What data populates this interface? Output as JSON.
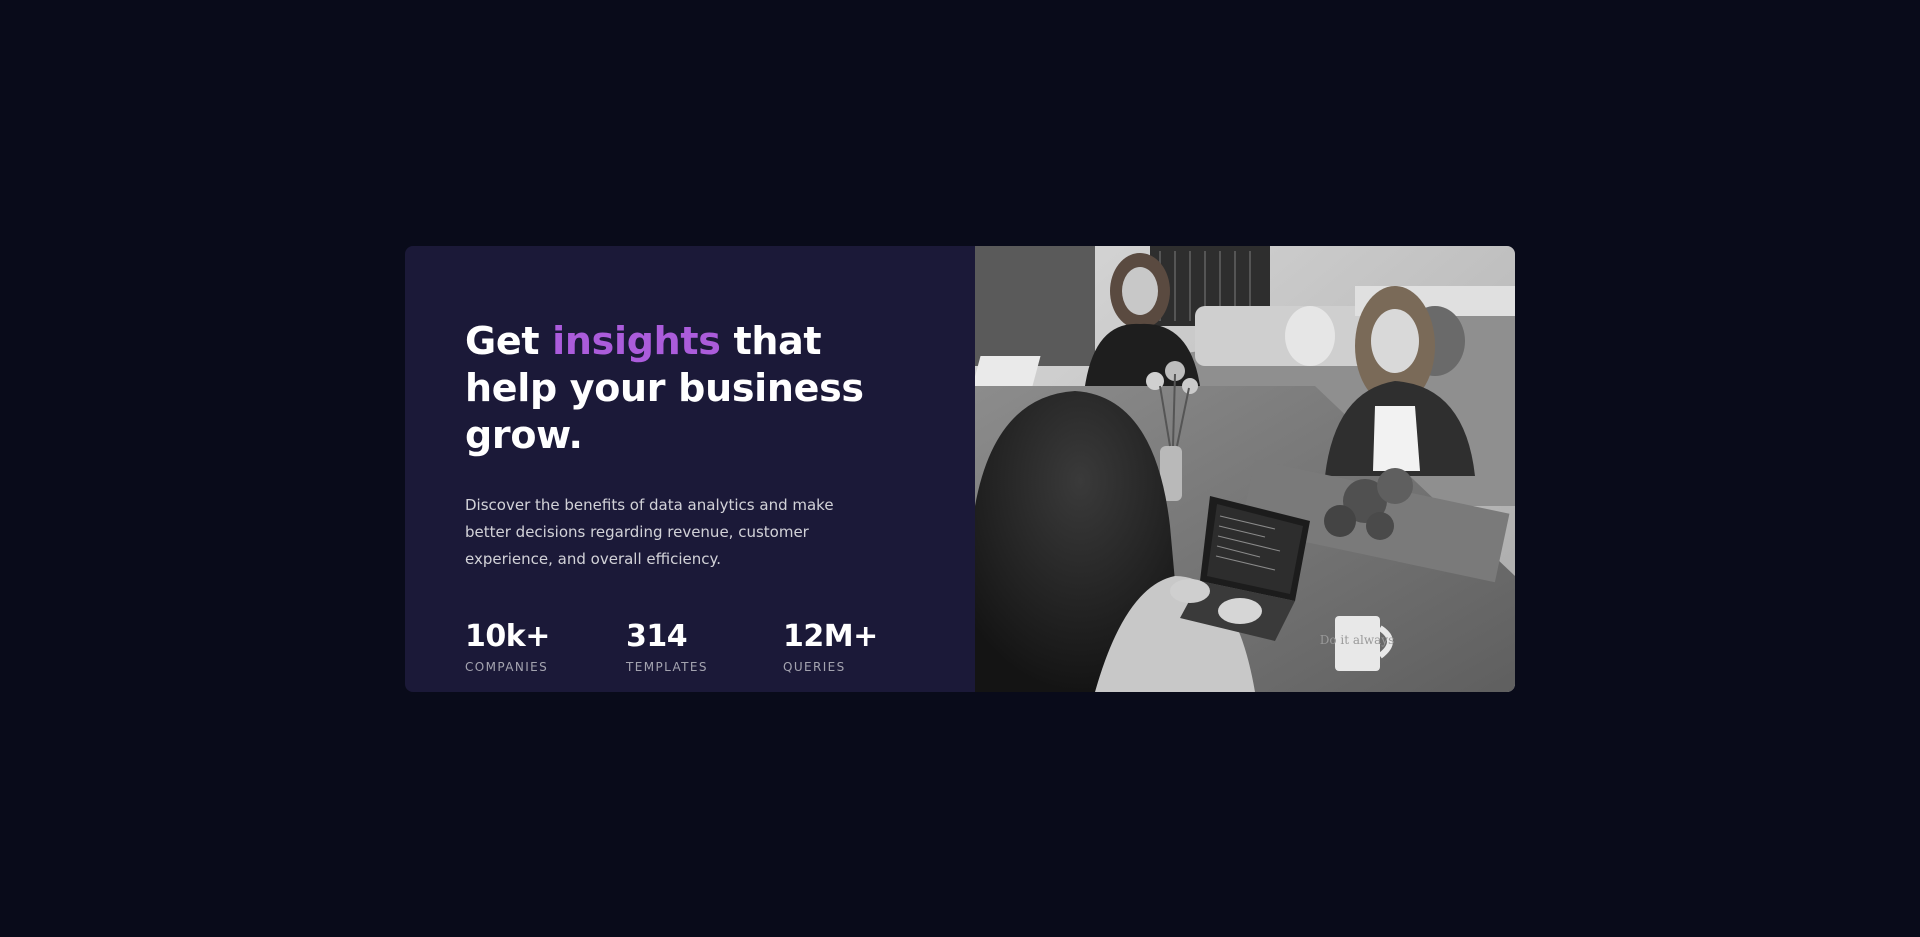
{
  "card": {
    "headline_prefix": "Get ",
    "headline_accent": "insights",
    "headline_suffix": " that help your business grow.",
    "description": "Discover the benefits of data analytics and make better decisions regarding revenue, customer experience, and overall efficiency.",
    "stats": [
      {
        "value": "10k+",
        "label": "COMPANIES"
      },
      {
        "value": "314",
        "label": "TEMPLATES"
      },
      {
        "value": "12M+",
        "label": "QUERIES"
      }
    ]
  },
  "image": {
    "description": "black-and-white photo of women working at laptops",
    "mug_text": "Do it always"
  },
  "colors": {
    "page_background": "#090b1a",
    "card_background": "#1b1938",
    "accent": "#ab5cdb",
    "text_primary": "#ffffff"
  }
}
